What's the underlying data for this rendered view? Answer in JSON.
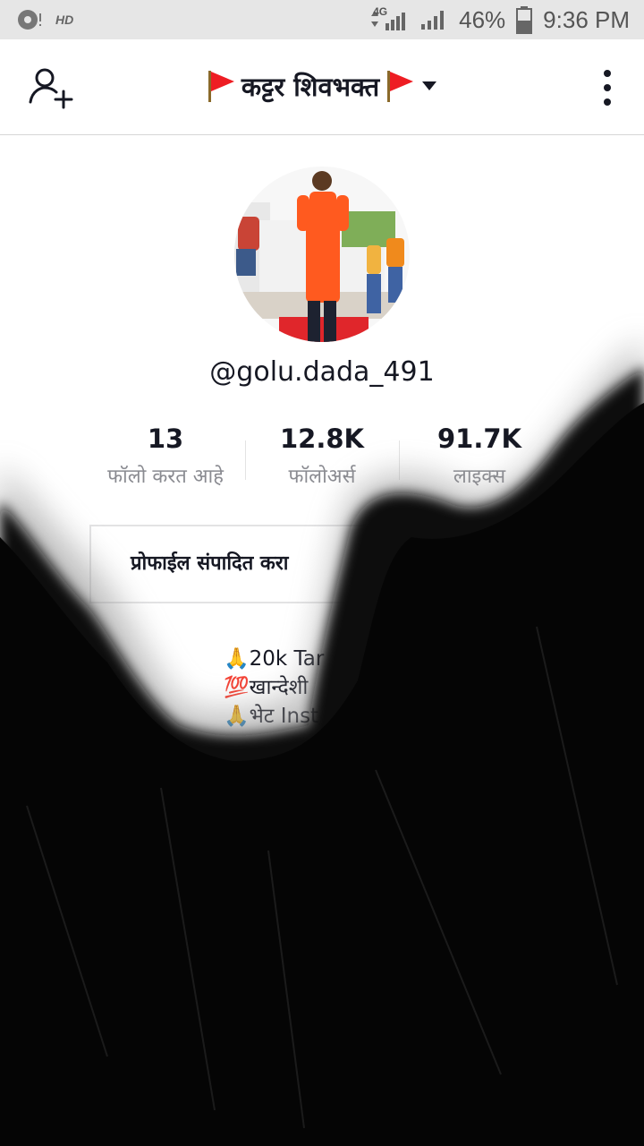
{
  "status_bar": {
    "hd_label": "HD",
    "network": "4G",
    "battery": "46%",
    "time": "9:36 PM"
  },
  "header": {
    "title": "कट्टर शिवभक्त",
    "icons": [
      "add-user-icon",
      "flag-icon",
      "chevron-down-icon",
      "more-vertical-icon"
    ]
  },
  "profile": {
    "username": "@golu.dada_491",
    "stats": [
      {
        "value": "13",
        "label": "फॉलो करत आहे"
      },
      {
        "value": "12.8K",
        "label": "फॉलोअर्स"
      },
      {
        "value": "91.7K",
        "label": "लाइक्स"
      }
    ],
    "edit_button": "प्रोफाईल संपादित करा",
    "bio_lines": [
      "🙏20k Tar",
      "💯खान्देशी",
      "🙏भेट Inst"
    ]
  },
  "colors": {
    "text": "#161823",
    "muted": "#8a8b91",
    "flag": "#ee1d23",
    "overlay": "#0b0b0b"
  }
}
